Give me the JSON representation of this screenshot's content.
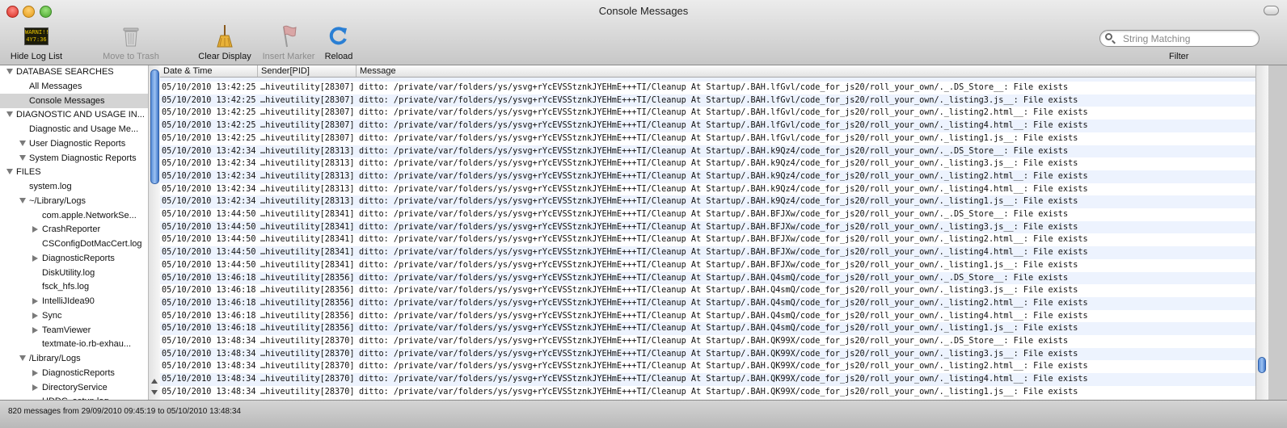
{
  "window": {
    "title": "Console Messages"
  },
  "toolbar": {
    "hide_log_list": {
      "label": "Hide Log List",
      "icon_text": "WARNI!! 4Y7:36"
    },
    "move_to_trash": {
      "label": "Move to Trash"
    },
    "clear_display": {
      "label": "Clear Display"
    },
    "insert_marker": {
      "label": "Insert Marker"
    },
    "reload": {
      "label": "Reload"
    },
    "search": {
      "placeholder": "String Matching",
      "value": ""
    },
    "filter_label": "Filter"
  },
  "sidebar": {
    "items": [
      {
        "label": "DATABASE SEARCHES",
        "level": 0,
        "disclosure": "open"
      },
      {
        "label": "All Messages",
        "level": 1,
        "disclosure": "none"
      },
      {
        "label": "Console Messages",
        "level": 1,
        "disclosure": "none",
        "selected": true
      },
      {
        "label": "DIAGNOSTIC AND USAGE IN...",
        "level": 0,
        "disclosure": "open"
      },
      {
        "label": "Diagnostic and Usage Me...",
        "level": 1,
        "disclosure": "none"
      },
      {
        "label": "User Diagnostic Reports",
        "level": 1,
        "disclosure": "open"
      },
      {
        "label": "System Diagnostic Reports",
        "level": 1,
        "disclosure": "open"
      },
      {
        "label": "FILES",
        "level": 0,
        "disclosure": "open"
      },
      {
        "label": "system.log",
        "level": 1,
        "disclosure": "none"
      },
      {
        "label": "~/Library/Logs",
        "level": 1,
        "disclosure": "open"
      },
      {
        "label": "com.apple.NetworkSe...",
        "level": 2,
        "disclosure": "none"
      },
      {
        "label": "CrashReporter",
        "level": 2,
        "disclosure": "closed"
      },
      {
        "label": "CSConfigDotMacCert.log",
        "level": 2,
        "disclosure": "none"
      },
      {
        "label": "DiagnosticReports",
        "level": 2,
        "disclosure": "closed"
      },
      {
        "label": "DiskUtility.log",
        "level": 2,
        "disclosure": "none"
      },
      {
        "label": "fsck_hfs.log",
        "level": 2,
        "disclosure": "none"
      },
      {
        "label": "IntelliJIdea90",
        "level": 2,
        "disclosure": "closed"
      },
      {
        "label": "Sync",
        "level": 2,
        "disclosure": "closed"
      },
      {
        "label": "TeamViewer",
        "level": 2,
        "disclosure": "closed"
      },
      {
        "label": "textmate-io.rb-exhau...",
        "level": 2,
        "disclosure": "none"
      },
      {
        "label": "/Library/Logs",
        "level": 1,
        "disclosure": "open"
      },
      {
        "label": "DiagnosticReports",
        "level": 2,
        "disclosure": "closed"
      },
      {
        "label": "DirectoryService",
        "level": 2,
        "disclosure": "closed"
      },
      {
        "label": "HDDC_setup.log",
        "level": 2,
        "disclosure": "none"
      }
    ]
  },
  "table": {
    "columns": [
      "Date & Time",
      "Sender[PID]",
      "Message"
    ],
    "rows": [
      [
        "05/10/2010 13:42:25",
        "…hiveutility[28307]",
        "ditto: /private/var/folders/ys/ysvg+rYcEVSStznkJYEHmE+++TI/Cleanup At Startup/.BAH.lfGvl/code_for_js20/roll_your_own/._.DS_Store__: File exists"
      ],
      [
        "05/10/2010 13:42:25",
        "…hiveutility[28307]",
        "ditto: /private/var/folders/ys/ysvg+rYcEVSStznkJYEHmE+++TI/Cleanup At Startup/.BAH.lfGvl/code_for_js20/roll_your_own/._listing3.js__: File exists"
      ],
      [
        "05/10/2010 13:42:25",
        "…hiveutility[28307]",
        "ditto: /private/var/folders/ys/ysvg+rYcEVSStznkJYEHmE+++TI/Cleanup At Startup/.BAH.lfGvl/code_for_js20/roll_your_own/._listing2.html__: File exists"
      ],
      [
        "05/10/2010 13:42:25",
        "…hiveutility[28307]",
        "ditto: /private/var/folders/ys/ysvg+rYcEVSStznkJYEHmE+++TI/Cleanup At Startup/.BAH.lfGvl/code_for_js20/roll_your_own/._listing4.html__: File exists"
      ],
      [
        "05/10/2010 13:42:25",
        "…hiveutility[28307]",
        "ditto: /private/var/folders/ys/ysvg+rYcEVSStznkJYEHmE+++TI/Cleanup At Startup/.BAH.lfGvl/code_for_js20/roll_your_own/._listing1.js__: File exists"
      ],
      [
        "05/10/2010 13:42:34",
        "…hiveutility[28313]",
        "ditto: /private/var/folders/ys/ysvg+rYcEVSStznkJYEHmE+++TI/Cleanup At Startup/.BAH.k9Qz4/code_for_js20/roll_your_own/._.DS_Store__: File exists"
      ],
      [
        "05/10/2010 13:42:34",
        "…hiveutility[28313]",
        "ditto: /private/var/folders/ys/ysvg+rYcEVSStznkJYEHmE+++TI/Cleanup At Startup/.BAH.k9Qz4/code_for_js20/roll_your_own/._listing3.js__: File exists"
      ],
      [
        "05/10/2010 13:42:34",
        "…hiveutility[28313]",
        "ditto: /private/var/folders/ys/ysvg+rYcEVSStznkJYEHmE+++TI/Cleanup At Startup/.BAH.k9Qz4/code_for_js20/roll_your_own/._listing2.html__: File exists"
      ],
      [
        "05/10/2010 13:42:34",
        "…hiveutility[28313]",
        "ditto: /private/var/folders/ys/ysvg+rYcEVSStznkJYEHmE+++TI/Cleanup At Startup/.BAH.k9Qz4/code_for_js20/roll_your_own/._listing4.html__: File exists"
      ],
      [
        "05/10/2010 13:42:34",
        "…hiveutility[28313]",
        "ditto: /private/var/folders/ys/ysvg+rYcEVSStznkJYEHmE+++TI/Cleanup At Startup/.BAH.k9Qz4/code_for_js20/roll_your_own/._listing1.js__: File exists"
      ],
      [
        "05/10/2010 13:44:50",
        "…hiveutility[28341]",
        "ditto: /private/var/folders/ys/ysvg+rYcEVSStznkJYEHmE+++TI/Cleanup At Startup/.BAH.BFJXw/code_for_js20/roll_your_own/._.DS_Store__: File exists"
      ],
      [
        "05/10/2010 13:44:50",
        "…hiveutility[28341]",
        "ditto: /private/var/folders/ys/ysvg+rYcEVSStznkJYEHmE+++TI/Cleanup At Startup/.BAH.BFJXw/code_for_js20/roll_your_own/._listing3.js__: File exists"
      ],
      [
        "05/10/2010 13:44:50",
        "…hiveutility[28341]",
        "ditto: /private/var/folders/ys/ysvg+rYcEVSStznkJYEHmE+++TI/Cleanup At Startup/.BAH.BFJXw/code_for_js20/roll_your_own/._listing2.html__: File exists"
      ],
      [
        "05/10/2010 13:44:50",
        "…hiveutility[28341]",
        "ditto: /private/var/folders/ys/ysvg+rYcEVSStznkJYEHmE+++TI/Cleanup At Startup/.BAH.BFJXw/code_for_js20/roll_your_own/._listing4.html__: File exists"
      ],
      [
        "05/10/2010 13:44:50",
        "…hiveutility[28341]",
        "ditto: /private/var/folders/ys/ysvg+rYcEVSStznkJYEHmE+++TI/Cleanup At Startup/.BAH.BFJXw/code_for_js20/roll_your_own/._listing1.js__: File exists"
      ],
      [
        "05/10/2010 13:46:18",
        "…hiveutility[28356]",
        "ditto: /private/var/folders/ys/ysvg+rYcEVSStznkJYEHmE+++TI/Cleanup At Startup/.BAH.Q4smQ/code_for_js20/roll_your_own/._.DS_Store__: File exists"
      ],
      [
        "05/10/2010 13:46:18",
        "…hiveutility[28356]",
        "ditto: /private/var/folders/ys/ysvg+rYcEVSStznkJYEHmE+++TI/Cleanup At Startup/.BAH.Q4smQ/code_for_js20/roll_your_own/._listing3.js__: File exists"
      ],
      [
        "05/10/2010 13:46:18",
        "…hiveutility[28356]",
        "ditto: /private/var/folders/ys/ysvg+rYcEVSStznkJYEHmE+++TI/Cleanup At Startup/.BAH.Q4smQ/code_for_js20/roll_your_own/._listing2.html__: File exists"
      ],
      [
        "05/10/2010 13:46:18",
        "…hiveutility[28356]",
        "ditto: /private/var/folders/ys/ysvg+rYcEVSStznkJYEHmE+++TI/Cleanup At Startup/.BAH.Q4smQ/code_for_js20/roll_your_own/._listing4.html__: File exists"
      ],
      [
        "05/10/2010 13:46:18",
        "…hiveutility[28356]",
        "ditto: /private/var/folders/ys/ysvg+rYcEVSStznkJYEHmE+++TI/Cleanup At Startup/.BAH.Q4smQ/code_for_js20/roll_your_own/._listing1.js__: File exists"
      ],
      [
        "05/10/2010 13:48:34",
        "…hiveutility[28370]",
        "ditto: /private/var/folders/ys/ysvg+rYcEVSStznkJYEHmE+++TI/Cleanup At Startup/.BAH.QK99X/code_for_js20/roll_your_own/._.DS_Store__: File exists"
      ],
      [
        "05/10/2010 13:48:34",
        "…hiveutility[28370]",
        "ditto: /private/var/folders/ys/ysvg+rYcEVSStznkJYEHmE+++TI/Cleanup At Startup/.BAH.QK99X/code_for_js20/roll_your_own/._listing3.js__: File exists"
      ],
      [
        "05/10/2010 13:48:34",
        "…hiveutility[28370]",
        "ditto: /private/var/folders/ys/ysvg+rYcEVSStznkJYEHmE+++TI/Cleanup At Startup/.BAH.QK99X/code_for_js20/roll_your_own/._listing2.html__: File exists"
      ],
      [
        "05/10/2010 13:48:34",
        "…hiveutility[28370]",
        "ditto: /private/var/folders/ys/ysvg+rYcEVSStznkJYEHmE+++TI/Cleanup At Startup/.BAH.QK99X/code_for_js20/roll_your_own/._listing4.html__: File exists"
      ],
      [
        "05/10/2010 13:48:34",
        "…hiveutility[28370]",
        "ditto: /private/var/folders/ys/ysvg+rYcEVSStznkJYEHmE+++TI/Cleanup At Startup/.BAH.QK99X/code_for_js20/roll_your_own/._listing1.js__: File exists"
      ]
    ]
  },
  "status": {
    "text": "820 messages from 29/09/2010 09:45:19 to 05/10/2010 13:48:34"
  }
}
